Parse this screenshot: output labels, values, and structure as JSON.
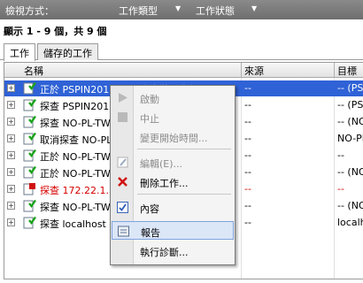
{
  "filter_bar": {
    "view_label": "檢視方式：",
    "job_type_label": "工作類型",
    "job_status_label": "工作狀態"
  },
  "summary": "顯示 1 - 9 個，共 9 個",
  "tabs": [
    {
      "label": "工作",
      "active": true
    },
    {
      "label": "儲存的工作",
      "active": false
    }
  ],
  "columns": {
    "name": "名稱",
    "source": "來源",
    "target": "目標"
  },
  "rows": [
    {
      "name": "正於 PSPIN2012TW1 上安裝影像伺服器",
      "source": "--",
      "target": "-- (PS",
      "selected": true,
      "status": "ok"
    },
    {
      "name": "探查 PSPIN2012TW1",
      "source": "--",
      "target": "-- (PS",
      "selected": false,
      "status": "ok"
    },
    {
      "name": "探查 NO-PL-TW...",
      "source": "--",
      "target": "-- (NO",
      "selected": false,
      "status": "ok"
    },
    {
      "name": "取消探查 NO-PL...",
      "source": "--",
      "target": "NO-PL",
      "selected": false,
      "status": "ok"
    },
    {
      "name": "正於 NO-PL-TW...",
      "source": "--",
      "target": "--",
      "selected": false,
      "status": "ok"
    },
    {
      "name": "正於 NO-PL-TW...",
      "source": "--",
      "target": "-- (NO",
      "selected": false,
      "status": "ok"
    },
    {
      "name": "探查 172.22.1.3...",
      "source": "--",
      "target": "--",
      "selected": false,
      "status": "error"
    },
    {
      "name": "探查 NO-PL-TW...",
      "source": "--",
      "target": "-- (NO",
      "selected": false,
      "status": "ok"
    },
    {
      "name": "探查 localhost 的...",
      "source": "--",
      "target": "localho",
      "selected": false,
      "status": "ok"
    }
  ],
  "context_menu": {
    "items": [
      {
        "label": "啟動",
        "enabled": false,
        "icon": "play-icon"
      },
      {
        "label": "中止",
        "enabled": false,
        "icon": "stop-icon"
      },
      {
        "label": "變更開始時間...",
        "enabled": false,
        "icon": ""
      },
      {
        "label": "編輯(E)...",
        "enabled": false,
        "icon": "edit-icon"
      },
      {
        "label": "刪除工作...",
        "enabled": true,
        "icon": "delete-icon"
      },
      {
        "label": "內容",
        "enabled": true,
        "icon": "properties-icon"
      },
      {
        "label": "報告",
        "enabled": true,
        "icon": "report-icon",
        "highlighted": true
      },
      {
        "label": "執行診斷...",
        "enabled": true,
        "icon": ""
      }
    ]
  },
  "colors": {
    "selection": "#2f62d6",
    "error_text": "#d40000",
    "menu_highlight": "#dbe6f7"
  }
}
